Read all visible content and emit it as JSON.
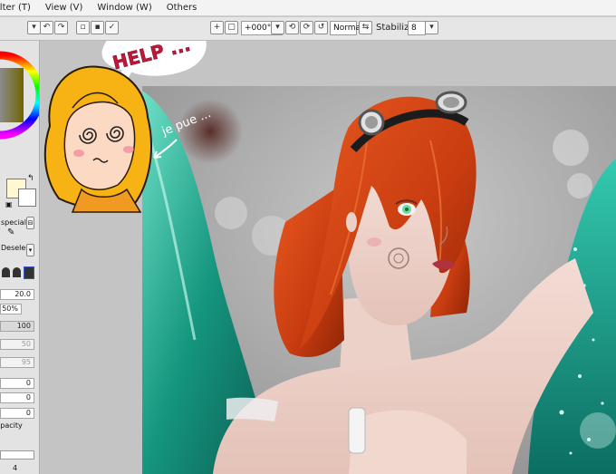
{
  "menu": {
    "items": [
      "Filter (T)",
      "View (V)",
      "Window (W)",
      "Others"
    ]
  },
  "toolbar": {
    "rotation": "+000°",
    "blend_mode": "Normal",
    "stabilizer_label": "Stabilizer",
    "stabilizer_value": "8"
  },
  "left_panel": {
    "special_label": "special",
    "deselect_label": "Deselect",
    "brush_size": "20.0",
    "min_size": "50%",
    "density": "100",
    "field_a": "50",
    "field_b": "95",
    "field_c": "0",
    "field_d": "0",
    "field_e": "0",
    "opacity_label": "Opacity",
    "bottom_value": "4"
  },
  "doodle": {
    "help_text": "HELP ...",
    "caption": "je pue ..."
  },
  "colors": {
    "menubar_bg": "#f3f3f3",
    "toolbar_bg": "#e6e6e6",
    "panel_bg": "#e3e3e3",
    "canvas_bg": "#c4c4c4",
    "hair": "#d2491d",
    "wing": "#1aa38a",
    "doodle_hair": "#f6b313"
  }
}
